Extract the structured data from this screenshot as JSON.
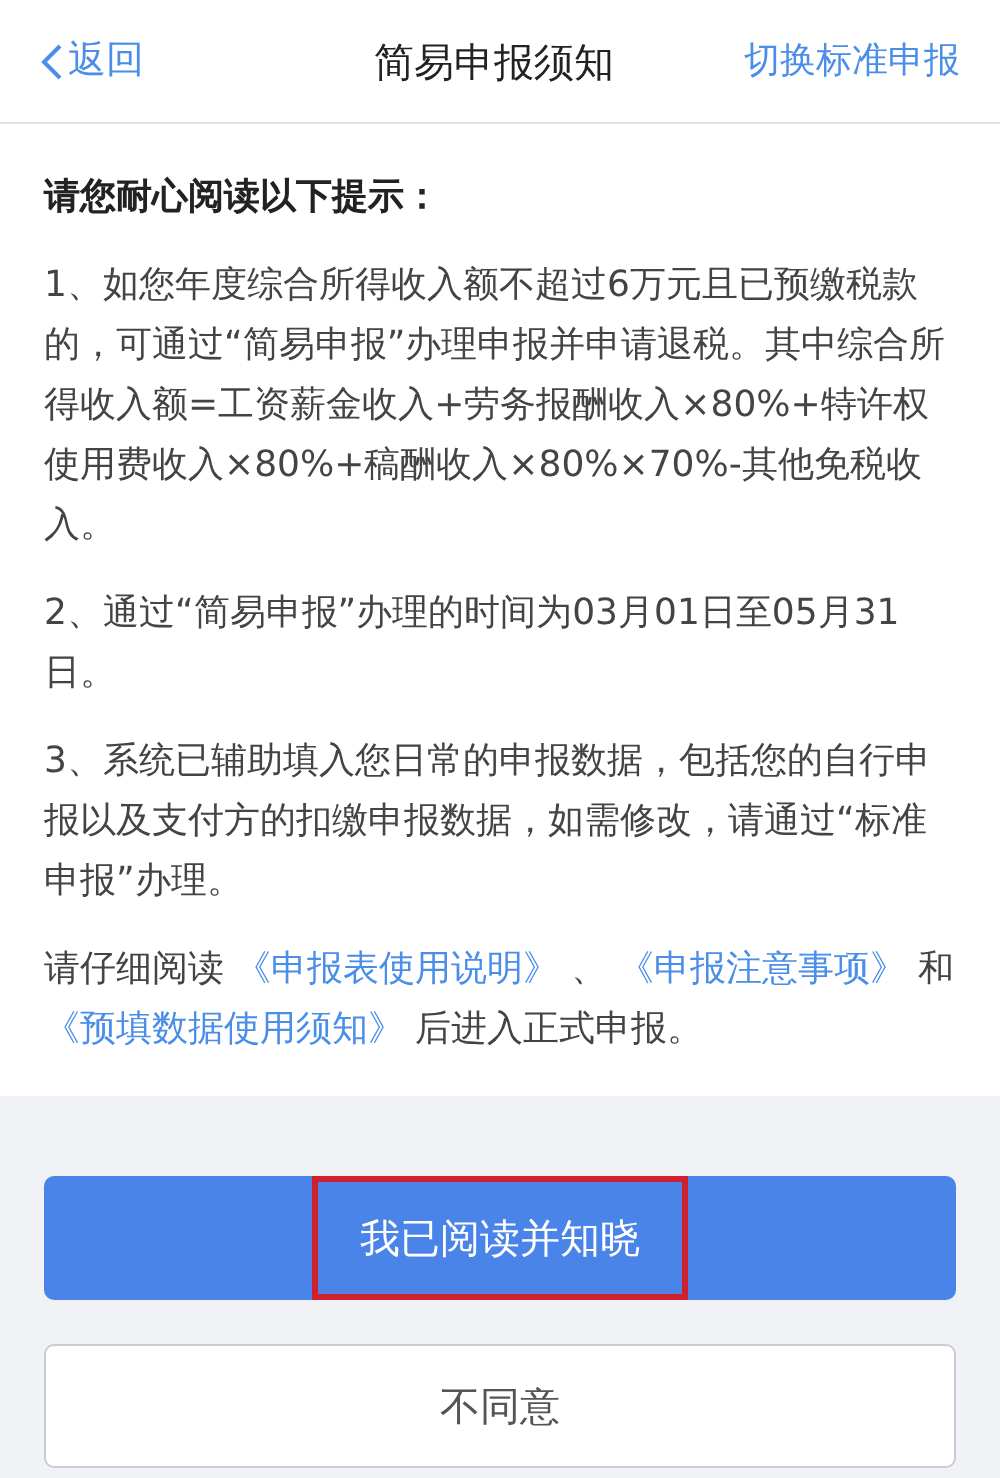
{
  "nav": {
    "back": "返回",
    "title": "简易申报须知",
    "action": "切换标准申报"
  },
  "heading": "请您耐心阅读以下提示：",
  "paragraphs": [
    "1、如您年度综合所得收入额不超过6万元且已预缴税款的，可通过“简易申报”办理申报并申请退税。其中综合所得收入额=工资薪金收入+劳务报酬收入×80%+特许权使用费收入×80%+稿酬收入×80%×70%-其他免税收入。",
    "2、通过“简易申报”办理的时间为03月01日至05月31日。",
    "3、系统已辅助填入您日常的申报数据，包括您的自行申报以及支付方的扣缴申报数据，如需修改，请通过“标准申报”办理。"
  ],
  "notice": [
    {
      "kind": "text",
      "text": "请仔细阅读 "
    },
    {
      "kind": "link",
      "text": "《申报表使用说明》"
    },
    {
      "kind": "text",
      "text": " 、 "
    },
    {
      "kind": "link",
      "text": "《申报注意事项》"
    },
    {
      "kind": "text",
      "text": " 和 "
    },
    {
      "kind": "link",
      "text": "《预填数据使用须知》"
    },
    {
      "kind": "text",
      "text": " 后进入正式申报。"
    }
  ],
  "buttons": [
    {
      "kind": "primary",
      "label": "我已阅读并知晓",
      "highlighted": true
    },
    {
      "kind": "secondary",
      "label": "不同意",
      "highlighted": false
    }
  ]
}
